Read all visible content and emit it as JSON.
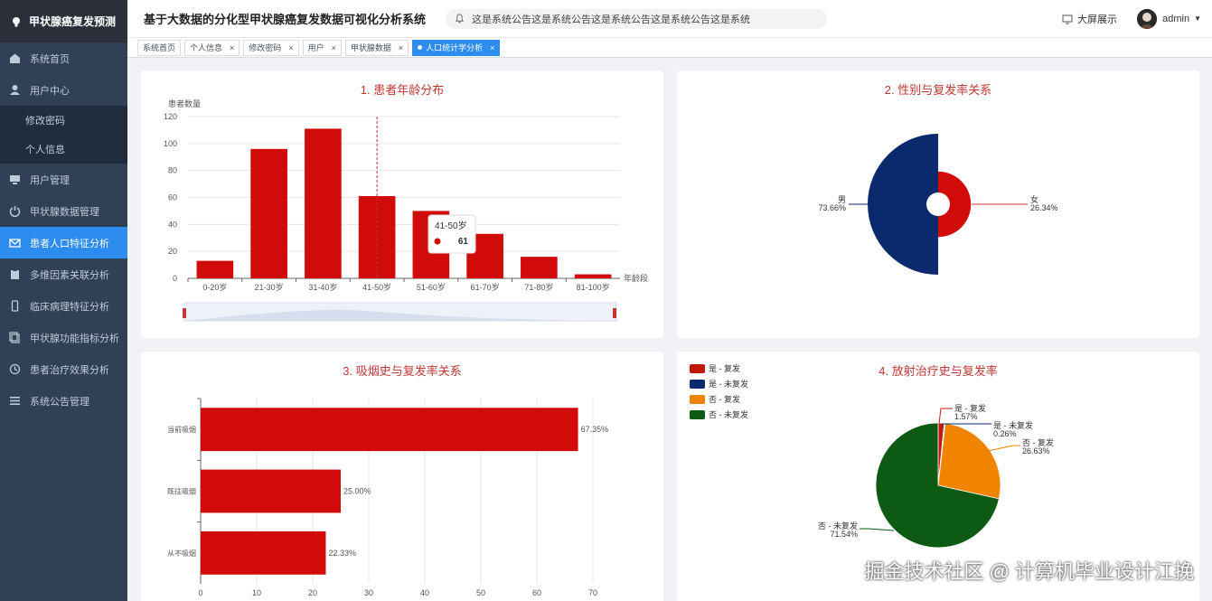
{
  "sidebar": {
    "logo_text": "甲状腺癌复发预测",
    "items": [
      {
        "label": "系统首页",
        "icon": "home-icon"
      },
      {
        "label": "用户中心",
        "icon": "user-icon"
      },
      {
        "label": "修改密码",
        "sub": true
      },
      {
        "label": "个人信息",
        "sub": true
      },
      {
        "label": "用户管理",
        "icon": "monitor-icon"
      },
      {
        "label": "甲状腺数据管理",
        "icon": "power-icon"
      },
      {
        "label": "患者人口特征分析",
        "icon": "mail-icon",
        "active": true
      },
      {
        "label": "多维因素关联分析",
        "icon": "clipboard-icon"
      },
      {
        "label": "临床病理特征分析",
        "icon": "phone-icon"
      },
      {
        "label": "甲状腺功能指标分析",
        "icon": "copy-icon"
      },
      {
        "label": "患者治疗效果分析",
        "icon": "clock-icon"
      },
      {
        "label": "系统公告管理",
        "icon": "list-icon"
      }
    ]
  },
  "header": {
    "title": "基于大数据的分化型甲状腺癌复发数据可视化分析系统",
    "notice": "这是系统公告这是系统公告这是系统公告这是系统公告这是系统",
    "big_screen": "大屏展示",
    "username": "admin"
  },
  "tags": [
    {
      "label": "系统首页",
      "closable": false
    },
    {
      "label": "个人信息",
      "closable": true
    },
    {
      "label": "修改密码",
      "closable": true
    },
    {
      "label": "用户",
      "closable": true
    },
    {
      "label": "甲状腺数据",
      "closable": true
    },
    {
      "label": "人口统计学分析",
      "closable": true,
      "active": true
    }
  ],
  "charts": {
    "age": {
      "title": "1. 患者年龄分布"
    },
    "gender": {
      "title": "2. 性别与复发率关系"
    },
    "smoking": {
      "title": "3. 吸烟史与复发率关系"
    },
    "radio": {
      "title": "4. 放射治疗史与复发率"
    }
  },
  "chart_data": [
    {
      "type": "bar",
      "title": "1. 患者年龄分布",
      "ylabel": "患者数量",
      "xlabel": "年龄段",
      "ylim": [
        0,
        120
      ],
      "yticks": [
        0,
        20,
        40,
        60,
        80,
        100,
        120
      ],
      "categories": [
        "0-20岁",
        "21-30岁",
        "31-40岁",
        "41-50岁",
        "51-60岁",
        "61-70岁",
        "71-80岁",
        "81-100岁"
      ],
      "values": [
        13,
        96,
        111,
        61,
        50,
        33,
        16,
        3
      ],
      "color": "#d10a0a",
      "tooltip": {
        "category": "41-50岁",
        "value": 61
      }
    },
    {
      "type": "pie",
      "title": "2. 性别与复发率关系",
      "slices": [
        {
          "name": "男",
          "label": "73.66%",
          "value": 73.66,
          "color": "#0b2a6e"
        },
        {
          "name": "女",
          "label": "26.34%",
          "value": 26.34,
          "color": "#d10a0a"
        }
      ]
    },
    {
      "type": "bar",
      "orientation": "horizontal",
      "title": "3. 吸烟史与复发率关系",
      "xlim": [
        0,
        70
      ],
      "xticks": [
        0,
        10,
        20,
        30,
        40,
        50,
        60,
        70
      ],
      "categories": [
        "当前吸烟",
        "既往吸烟",
        "从不吸烟"
      ],
      "values": [
        67.35,
        25.0,
        22.33
      ],
      "labels": [
        "67.35%",
        "25.00%",
        "22.33%"
      ],
      "color": "#d10a0a"
    },
    {
      "type": "pie",
      "title": "4. 放射治疗史与复发率",
      "legend_position": "top-left",
      "slices": [
        {
          "name": "是 - 复发",
          "label": "1.57%",
          "value": 1.57,
          "color": "#c0180e"
        },
        {
          "name": "是 - 未复发",
          "label": "0.26%",
          "value": 0.26,
          "color": "#0b2a6e"
        },
        {
          "name": "否 - 复发",
          "label": "26.63%",
          "value": 26.63,
          "color": "#f08300"
        },
        {
          "name": "否 - 未复发",
          "label": "71.54%",
          "value": 71.54,
          "color": "#0d5a12"
        }
      ]
    }
  ],
  "watermark": "掘金技术社区 @ 计算机毕业设计江挽"
}
